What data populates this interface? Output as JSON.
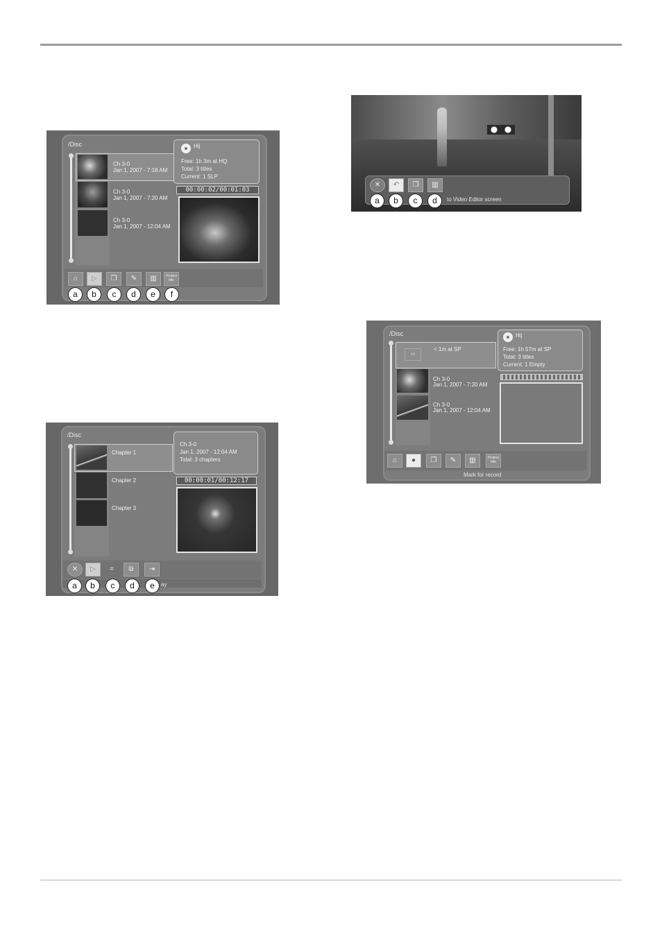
{
  "fig1": {
    "path": "/Disc",
    "rows": [
      {
        "line1": "Ch 3-0",
        "line2": "Jan 1, 2007 - 7:18 AM"
      },
      {
        "line1": "Ch 3-0",
        "line2": "Jan 1, 2007 - 7:20 AM"
      },
      {
        "line1": "Ch 3-0",
        "line2": "Jan 1, 2007 - 12:04 AM"
      }
    ],
    "disc_name": "Hij",
    "info": [
      "Free: 1h 3m at HQ",
      "Total: 3 titles",
      "Current: 1  SLP"
    ],
    "time": "00:00:02/00:01:03",
    "protect_label": "Protect title",
    "callouts": [
      "a",
      "b",
      "c",
      "d",
      "e",
      "f"
    ]
  },
  "fig2": {
    "path": "/Disc",
    "rows": [
      {
        "line1": "Chapter 1"
      },
      {
        "line1": "Chapter 2"
      },
      {
        "line1": "Chapter 3"
      }
    ],
    "info": [
      "Ch 3-0",
      "Jan 1, 2007 - 12:04 AM",
      "Total: 3 chapters"
    ],
    "time": "00:00:01/00:12:17",
    "status": "ay",
    "callouts": [
      "a",
      "b",
      "c",
      "d",
      "e"
    ]
  },
  "fig3": {
    "status": "to Video Editor screen",
    "callouts": [
      "a",
      "b",
      "c",
      "d"
    ]
  },
  "fig4": {
    "path": "/Disc",
    "rows": [
      {
        "line1": "< 1m at SP"
      },
      {
        "line1": "Ch 3-0",
        "line2": "Jan 1, 2007 - 7:20 AM"
      },
      {
        "line1": "Ch 3-0",
        "line2": "Jan 1, 2007 - 12:04 AM"
      }
    ],
    "disc_name": "Hij",
    "info": [
      "Free: 1h 57m at SP",
      "Total: 3 titles",
      "Current: 1  Empty"
    ],
    "protect_label": "Protect title",
    "status": "Mark for record"
  }
}
